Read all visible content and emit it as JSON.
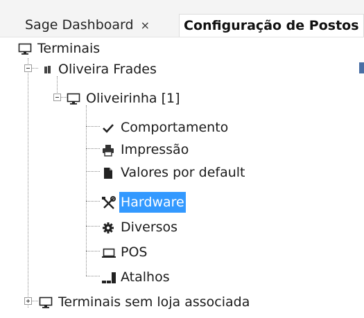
{
  "tabs": {
    "dashboard": {
      "label": "Sage Dashboard",
      "close": "×"
    },
    "config": {
      "label": "Configuração de Postos"
    }
  },
  "tree": {
    "root": "Terminais",
    "store": "Oliveira Frades",
    "terminal": "Oliveirinha [1]",
    "items": {
      "comportamento": "Comportamento",
      "impressao": "Impressão",
      "valores": "Valores por default",
      "hardware": "Hardware",
      "diversos": "Diversos",
      "pos": "POS",
      "atalhos": "Atalhos"
    },
    "unassigned": "Terminais sem loja associada",
    "selected": "Hardware"
  },
  "colors": {
    "selection": "#3399ff",
    "accent": "#4a6fa5"
  }
}
